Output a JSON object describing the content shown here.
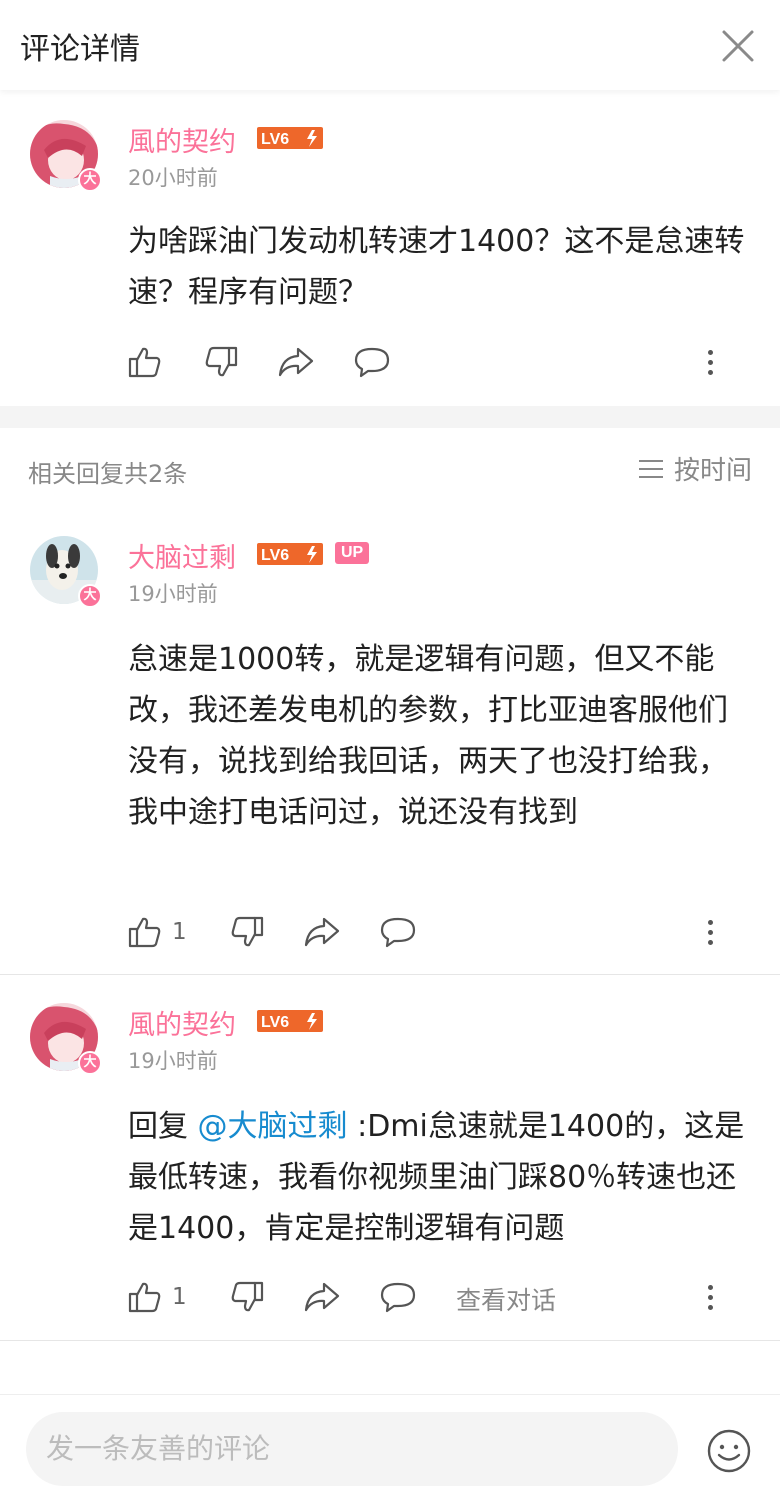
{
  "header": {
    "title": "评论详情"
  },
  "root_comment": {
    "username": "風的契约",
    "level": "LV6",
    "vip_badge": "大",
    "time": "20小时前",
    "content": "为啥踩油门发动机转速才1400？这不是怠速转速？程序有问题？"
  },
  "replies_section": {
    "count_label": "相关回复共2条",
    "sort_label": "按时间"
  },
  "replies": [
    {
      "username": "大脑过剩",
      "level": "LV6",
      "up_badge": "UP",
      "vip_badge": "大",
      "time": "19小时前",
      "content": "怠速是1000转，就是逻辑有问题，但又不能改，我还差发电机的参数，打比亚迪客服他们没有，说找到给我回话，两天了也没打给我，我中途打电话问过，说还没有找到",
      "like_count": "1"
    },
    {
      "username": "風的契约",
      "level": "LV6",
      "vip_badge": "大",
      "time": "19小时前",
      "reply_prefix": "回复 ",
      "mention": "@大脑过剩",
      "content": " :Dmi怠速就是1400的，这是最低转速，我看你视频里油门踩80％转速也还是1400，肯定是控制逻辑有问题",
      "like_count": "1",
      "view_conversation": "查看对话"
    }
  ],
  "footer": {
    "input_placeholder": "发一条友善的评论"
  },
  "colors": {
    "accent_pink": "#fb7299",
    "mention_blue": "#178bcf",
    "divider": "#f4f4f4"
  }
}
